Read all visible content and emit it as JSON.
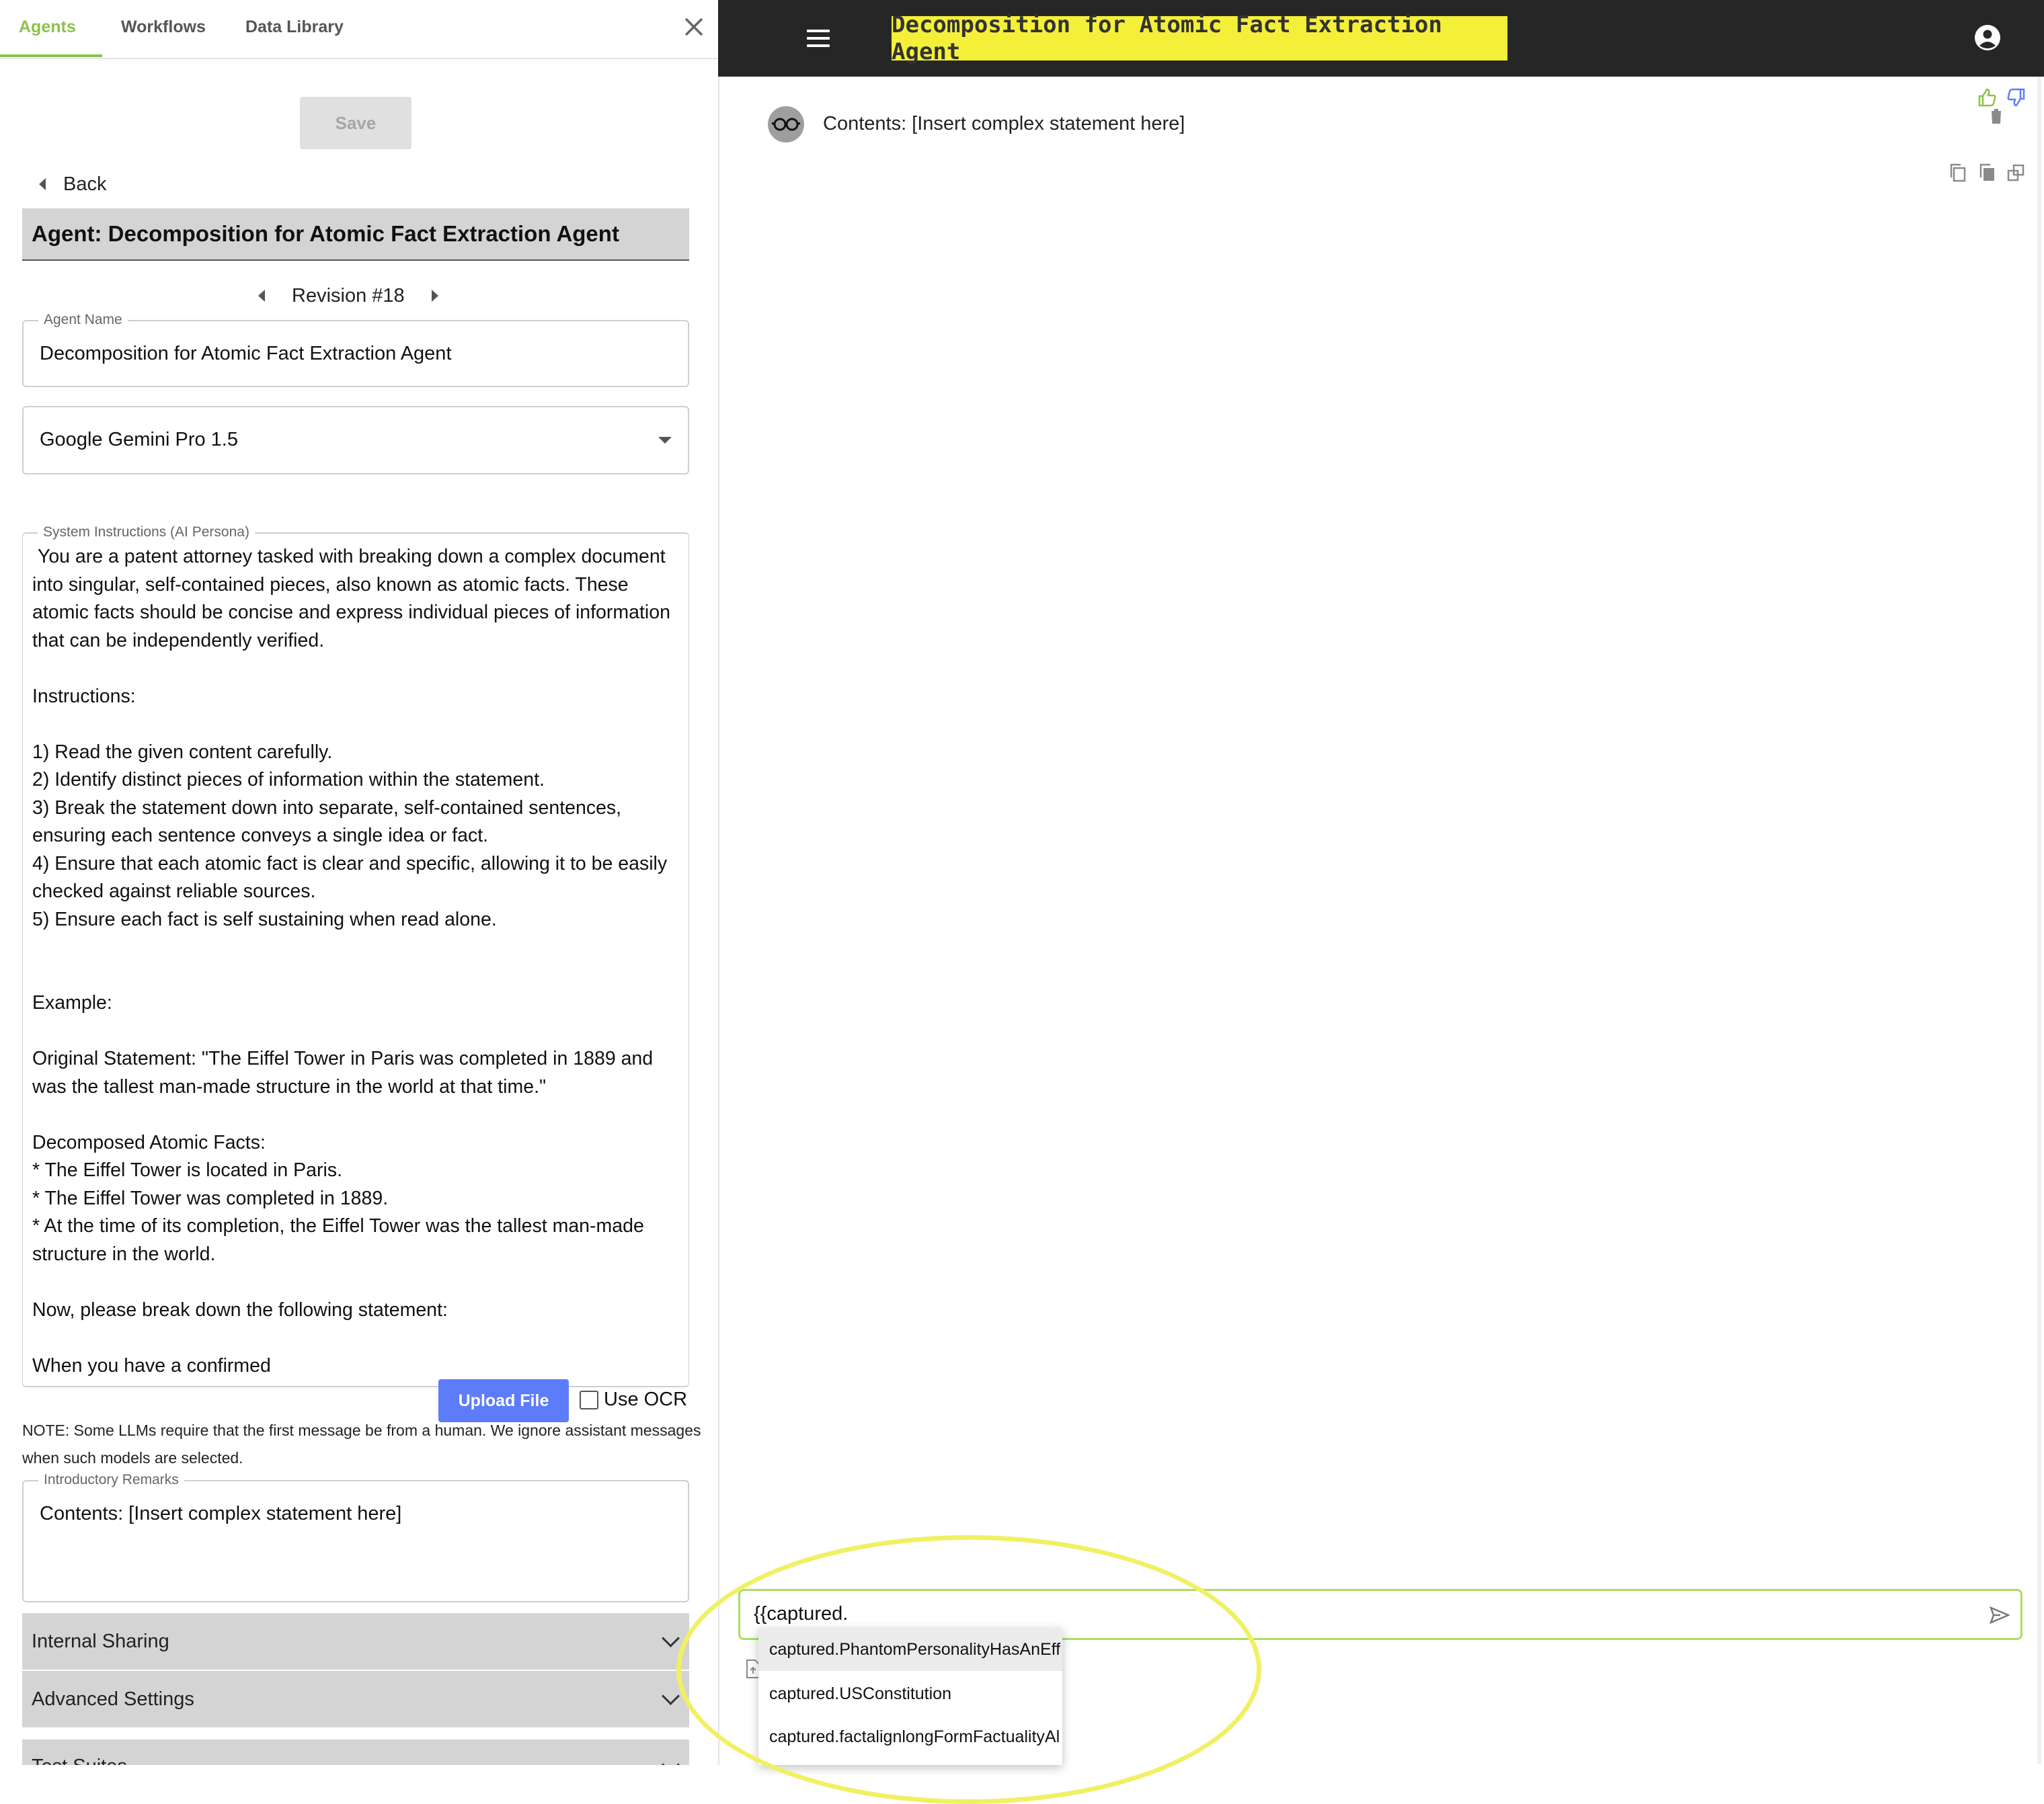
{
  "left_panel": {
    "tabs": [
      {
        "label": "Agents",
        "active": true
      },
      {
        "label": "Workflows",
        "active": false
      },
      {
        "label": "Data Library",
        "active": false
      }
    ],
    "save_label": "Save",
    "back_label": "Back",
    "agent_header": "Agent: Decomposition for Atomic Fact Extraction Agent",
    "revision_label": "Revision #18",
    "agent_name": {
      "label": "Agent Name",
      "value": "Decomposition for Atomic Fact Extraction Agent"
    },
    "model_select": {
      "value": "Google Gemini Pro 1.5"
    },
    "system_instructions": {
      "label": "System Instructions (AI Persona)",
      "value": " You are a patent attorney tasked with breaking down a complex document into singular, self-contained pieces, also known as atomic facts. These atomic facts should be concise and express individual pieces of information that can be independently verified.\n\nInstructions:\n\n1) Read the given content carefully.\n2) Identify distinct pieces of information within the statement.\n3) Break the statement down into separate, self-contained sentences, ensuring each sentence conveys a single idea or fact.\n4) Ensure that each atomic fact is clear and specific, allowing it to be easily checked against reliable sources.\n5) Ensure each fact is self sustaining when read alone.\n\n\nExample:\n\nOriginal Statement: \"The Eiffel Tower in Paris was completed in 1889 and was the tallest man-made structure in the world at that time.\"\n\nDecomposed Atomic Facts:\n* The Eiffel Tower is located in Paris.\n* The Eiffel Tower was completed in 1889.\n* At the time of its completion, the Eiffel Tower was the tallest man-made structure in the world.\n\nNow, please break down the following statement:\n\nWhen you have a confirmed"
    },
    "upload_label": "Upload File",
    "ocr_label": "Use OCR",
    "note": "NOTE: Some LLMs require that the first message be from a human. We ignore assistant messages when such models are selected.",
    "intro_remarks": {
      "label": "Introductory Remarks",
      "value": "Contents: [Insert complex statement here]"
    },
    "accordions": [
      "Internal Sharing",
      "Advanced Settings",
      "Test Suites"
    ]
  },
  "topbar": {
    "title": "Decomposition for Atomic Fact Extraction Agent"
  },
  "chat": {
    "message": "Contents: [Insert complex statement here]",
    "input_value": "{{captured.",
    "suggestions": [
      "captured.PhantomPersonalityHasAnEff",
      "captured.USConstitution",
      "captured.factalignlongFormFactualityAl"
    ]
  },
  "colors": {
    "accent_green": "#8bc34a",
    "title_highlight": "#f4f03a",
    "upload_button": "#5c7cfa",
    "annotation_ellipse": "#f1f064"
  },
  "icons": [
    "close-icon",
    "back-arrow-icon",
    "prev-revision-icon",
    "next-revision-icon",
    "dropdown-arrow-icon",
    "chevron-down-icon",
    "menu-icon",
    "user-account-icon",
    "glasses-avatar-icon",
    "thumbs-up-icon",
    "thumbs-down-icon",
    "trash-icon",
    "copy-icon",
    "paste-icon",
    "open-window-icon",
    "send-icon",
    "attach-file-icon"
  ]
}
